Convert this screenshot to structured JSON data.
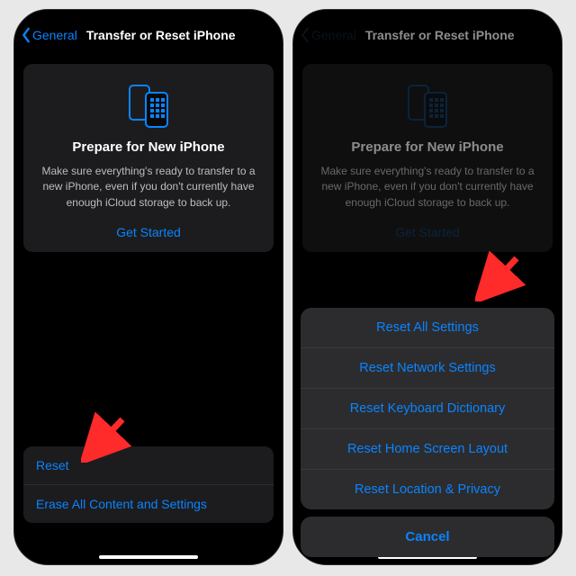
{
  "colors": {
    "accent": "#0a84ff",
    "cardBg": "#1c1c1e",
    "sheetBg": "#2c2c2e"
  },
  "nav": {
    "back": "General",
    "title": "Transfer or Reset iPhone"
  },
  "card": {
    "heading": "Prepare for New iPhone",
    "body": "Make sure everything's ready to transfer to a new iPhone, even if you don't currently have enough iCloud storage to back up.",
    "cta": "Get Started"
  },
  "options": {
    "reset": "Reset",
    "erase": "Erase All Content and Settings"
  },
  "sheet": {
    "items": [
      "Reset All Settings",
      "Reset Network Settings",
      "Reset Keyboard Dictionary",
      "Reset Home Screen Layout",
      "Reset Location & Privacy"
    ],
    "cancel": "Cancel"
  },
  "icons": {
    "back": "chevron-left-icon",
    "prepare": "two-iphones-icon"
  }
}
